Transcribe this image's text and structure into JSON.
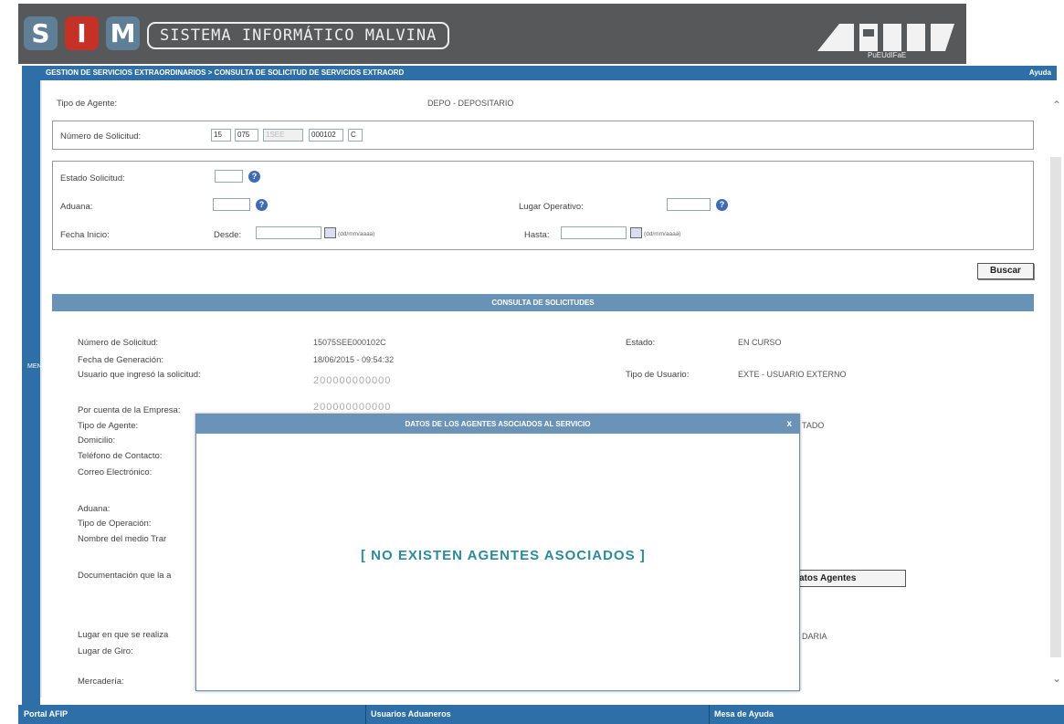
{
  "header": {
    "logo_s": "S",
    "logo_i": "I",
    "logo_m": "M",
    "system_name": "SISTEMA INFORMÁTICO MALVINA",
    "brand": "AFIP",
    "brand_sub": "PuEUdIFaE"
  },
  "nav": {
    "breadcrumb": "GESTION DE SERVICIOS EXTRAORDINARIOS > CONSULTA DE SOLICITUD DE SERVICIOS EXTRAORD",
    "help": "Ayuda"
  },
  "sidebar": {
    "label": "MENU"
  },
  "form": {
    "tipo_agente_label": "Tipo de Agente:",
    "tipo_agente_value": "DEPO - DEPOSITARIO",
    "numero_solicitud_label": "Número de Solicitud:",
    "numero_parts": [
      "15",
      "075",
      "1SEE",
      "000102",
      "C"
    ],
    "estado_label": "Estado Solicitud:",
    "aduana_label": "Aduana:",
    "lugar_label": "Lugar Operativo:",
    "fecha_label": "Fecha Inicio:",
    "desde_label": "Desde:",
    "hasta_label": "Hasta:",
    "date_format": "(dd/mm/aaaa)",
    "help_icon": "?",
    "buscar": "Buscar"
  },
  "section_title": "CONSULTA DE SOLICITUDES",
  "detail": {
    "numero_label": "Número de Solicitud:",
    "numero_value": "15075SEE000102C",
    "fecha_gen_label": "Fecha de Generación:",
    "fecha_gen_value": "18/06/2015 - 09:54:32",
    "usuario_label": "Usuario que ingresó la solicitud:",
    "usuario_value": "200000000000",
    "estado_label": "Estado:",
    "estado_value": "EN CURSO",
    "tipo_usuario_label": "Tipo de Usuario:",
    "tipo_usuario_value": "EXTE - USUARIO EXTERNO",
    "empresa_label": "Por cuenta de la Empresa:",
    "empresa_value": "200000000000",
    "tipo_agente_label": "Tipo de Agente:",
    "tipo_agente_tail": "TADO",
    "domicilio_label": "Domicilio:",
    "telefono_label": "Teléfono de Contacto:",
    "correo_label": "Correo Electrónico:",
    "aduana_label": "Aduana:",
    "operacion_label": "Tipo de Operación:",
    "medio_label": "Nombre del medio Trar",
    "documentacion_label": "Documentación que la a",
    "datos_agentes_btn": "atos Agentes",
    "lugar_realiza_label": "Lugar en que se realiza",
    "lugar_realiza_tail": "DARIA",
    "lugar_giro_label": "Lugar de Giro:",
    "mercaderia_label": "Mercadería:"
  },
  "modal": {
    "title": "DATOS DE LOS AGENTES ASOCIADOS AL SERVICIO",
    "close": "x",
    "message": "[ NO EXISTEN AGENTES ASOCIADOS ]"
  },
  "footer": {
    "portal": "Portal AFIP",
    "usuarios": "Usuarios Aduaneros",
    "mesa": "Mesa de Ayuda"
  }
}
